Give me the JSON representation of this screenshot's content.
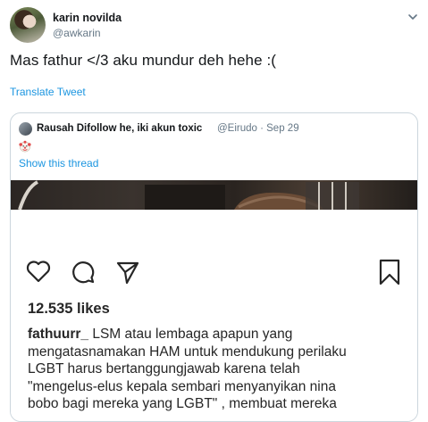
{
  "tweet": {
    "author_name": "karin novilda",
    "author_handle": "@awkarin",
    "text": "Mas fathur </3 aku mundur deh hehe :(",
    "translate_label": "Translate Tweet"
  },
  "quote": {
    "author_name": "Rausah Difollow he, iki akun toxic",
    "author_meta": "@Eirudo · Sep 29",
    "emoji": "clown-face-icon",
    "show_thread_label": "Show this thread"
  },
  "instagram": {
    "likes": "12.535 likes",
    "caption_user": "fathuurr_",
    "caption_lines": [
      " LSM atau lembaga apapun yang",
      "mengatasnamakan HAM untuk mendukung perilaku",
      "LGBT harus bertanggungjawab karena telah",
      "\"mengelus-elus kepala sembari menyanyikan nina",
      "bobo bagi mereka yang LGBT\" , membuat mereka"
    ]
  },
  "colors": {
    "link": "#1b95e0",
    "secondary_text": "#657786",
    "border": "#ccd6dd"
  }
}
